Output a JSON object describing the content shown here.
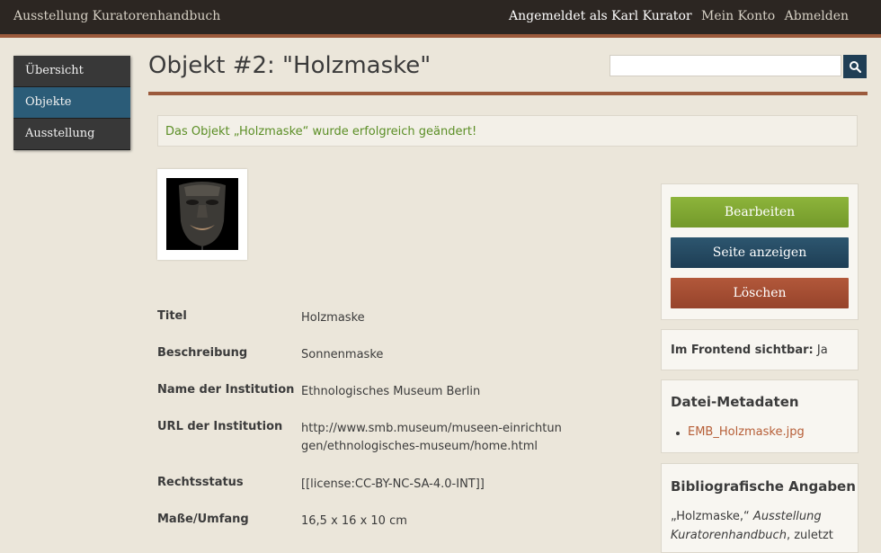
{
  "header": {
    "site_title": "Ausstellung Kuratorenhandbuch",
    "logged_in": "Angemeldet als Karl Kurator",
    "account": "Mein Konto",
    "logout": "Abmelden"
  },
  "sidebar": {
    "items": [
      {
        "label": "Übersicht"
      },
      {
        "label": "Objekte"
      },
      {
        "label": "Ausstellung"
      }
    ]
  },
  "page": {
    "title": "Objekt #2: \"Holzmaske\"",
    "flash": "Das Objekt „Holzmaske“ wurde erfolgreich geändert!"
  },
  "search": {
    "value": "",
    "icon": "search-icon"
  },
  "fields": [
    {
      "label": "Titel",
      "value": "Holzmaske"
    },
    {
      "label": "Beschreibung",
      "value": "Sonnenmaske"
    },
    {
      "label": "Name der Institution",
      "value": "Ethnologisches Museum Berlin"
    },
    {
      "label": "URL der Institution",
      "value": "http://www.smb.museum/museen-einrichtungen/ethnologisches-museum/home.html"
    },
    {
      "label": "Rechtsstatus",
      "value": "[[license:CC-BY-NC-SA-4.0-INT]]"
    },
    {
      "label": "Maße/Umfang",
      "value": "16,5 x 16 x 10 cm"
    }
  ],
  "actions": {
    "edit": "Bearbeiten",
    "view": "Seite anzeigen",
    "delete": "Löschen"
  },
  "visibility": {
    "label": "Im Frontend sichtbar:",
    "value": "Ja"
  },
  "file_metadata": {
    "heading": "Datei-Metadaten",
    "file": "EMB_Holzmaske.jpg"
  },
  "bibliography": {
    "heading": "Bibliografische Angaben",
    "line1_plain": "„Holzmaske,“",
    "line1_italic": "Ausstellung",
    "line2_italic": "Kuratorenhandbuch",
    "line2_rest": ", zuletzt"
  },
  "colors": {
    "accent": "#9b5a3c",
    "success": "#5b8e25",
    "active_nav": "#2b5c78",
    "edit_button": "#7ea632",
    "view_button": "#244a63",
    "delete_button": "#a54f32"
  }
}
